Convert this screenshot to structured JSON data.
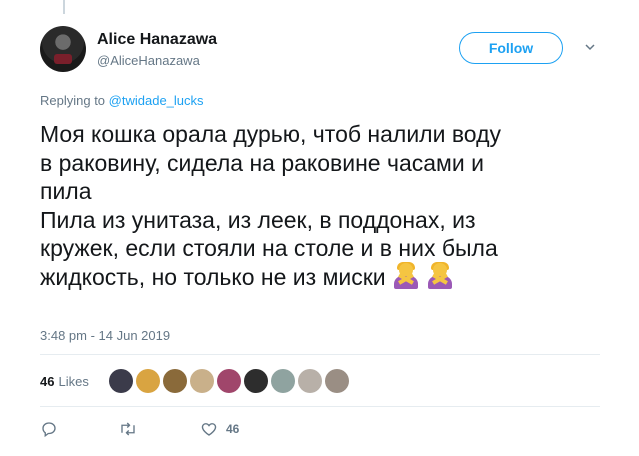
{
  "tweet": {
    "author": {
      "name": "Alice Hanazawa",
      "handle": "@AliceHanazawa"
    },
    "follow_label": "Follow",
    "replying_prefix": "Replying to",
    "replying_to": "@twidade_lucks",
    "text": "Моя кошка орала дурью, чтоб налили воду\nв раковину, сидела на раковине часами и\nпила\nПила из унитаза, из леек, в поддонах, из\nкружек, если стояли на столе и в них была\nжидкость, но только не из миски",
    "emoji_names": [
      "person-gesturing-no-emoji",
      "person-gesturing-no-emoji"
    ],
    "timestamp": "3:48 pm - 14 Jun 2019",
    "likes": {
      "count": "46",
      "label": "Likes",
      "liker_colors": [
        "#3b3b4a",
        "#d9a441",
        "#8a6a3a",
        "#c9b08a",
        "#a0466b",
        "#2d2d2d",
        "#8fa3a0",
        "#b8b0a8",
        "#9a8e84"
      ]
    },
    "actions": {
      "like_count": "46"
    }
  },
  "colors": {
    "accent": "#1da1f2",
    "muted": "#657786",
    "text": "#14171a",
    "divider": "#e6ecf0"
  }
}
